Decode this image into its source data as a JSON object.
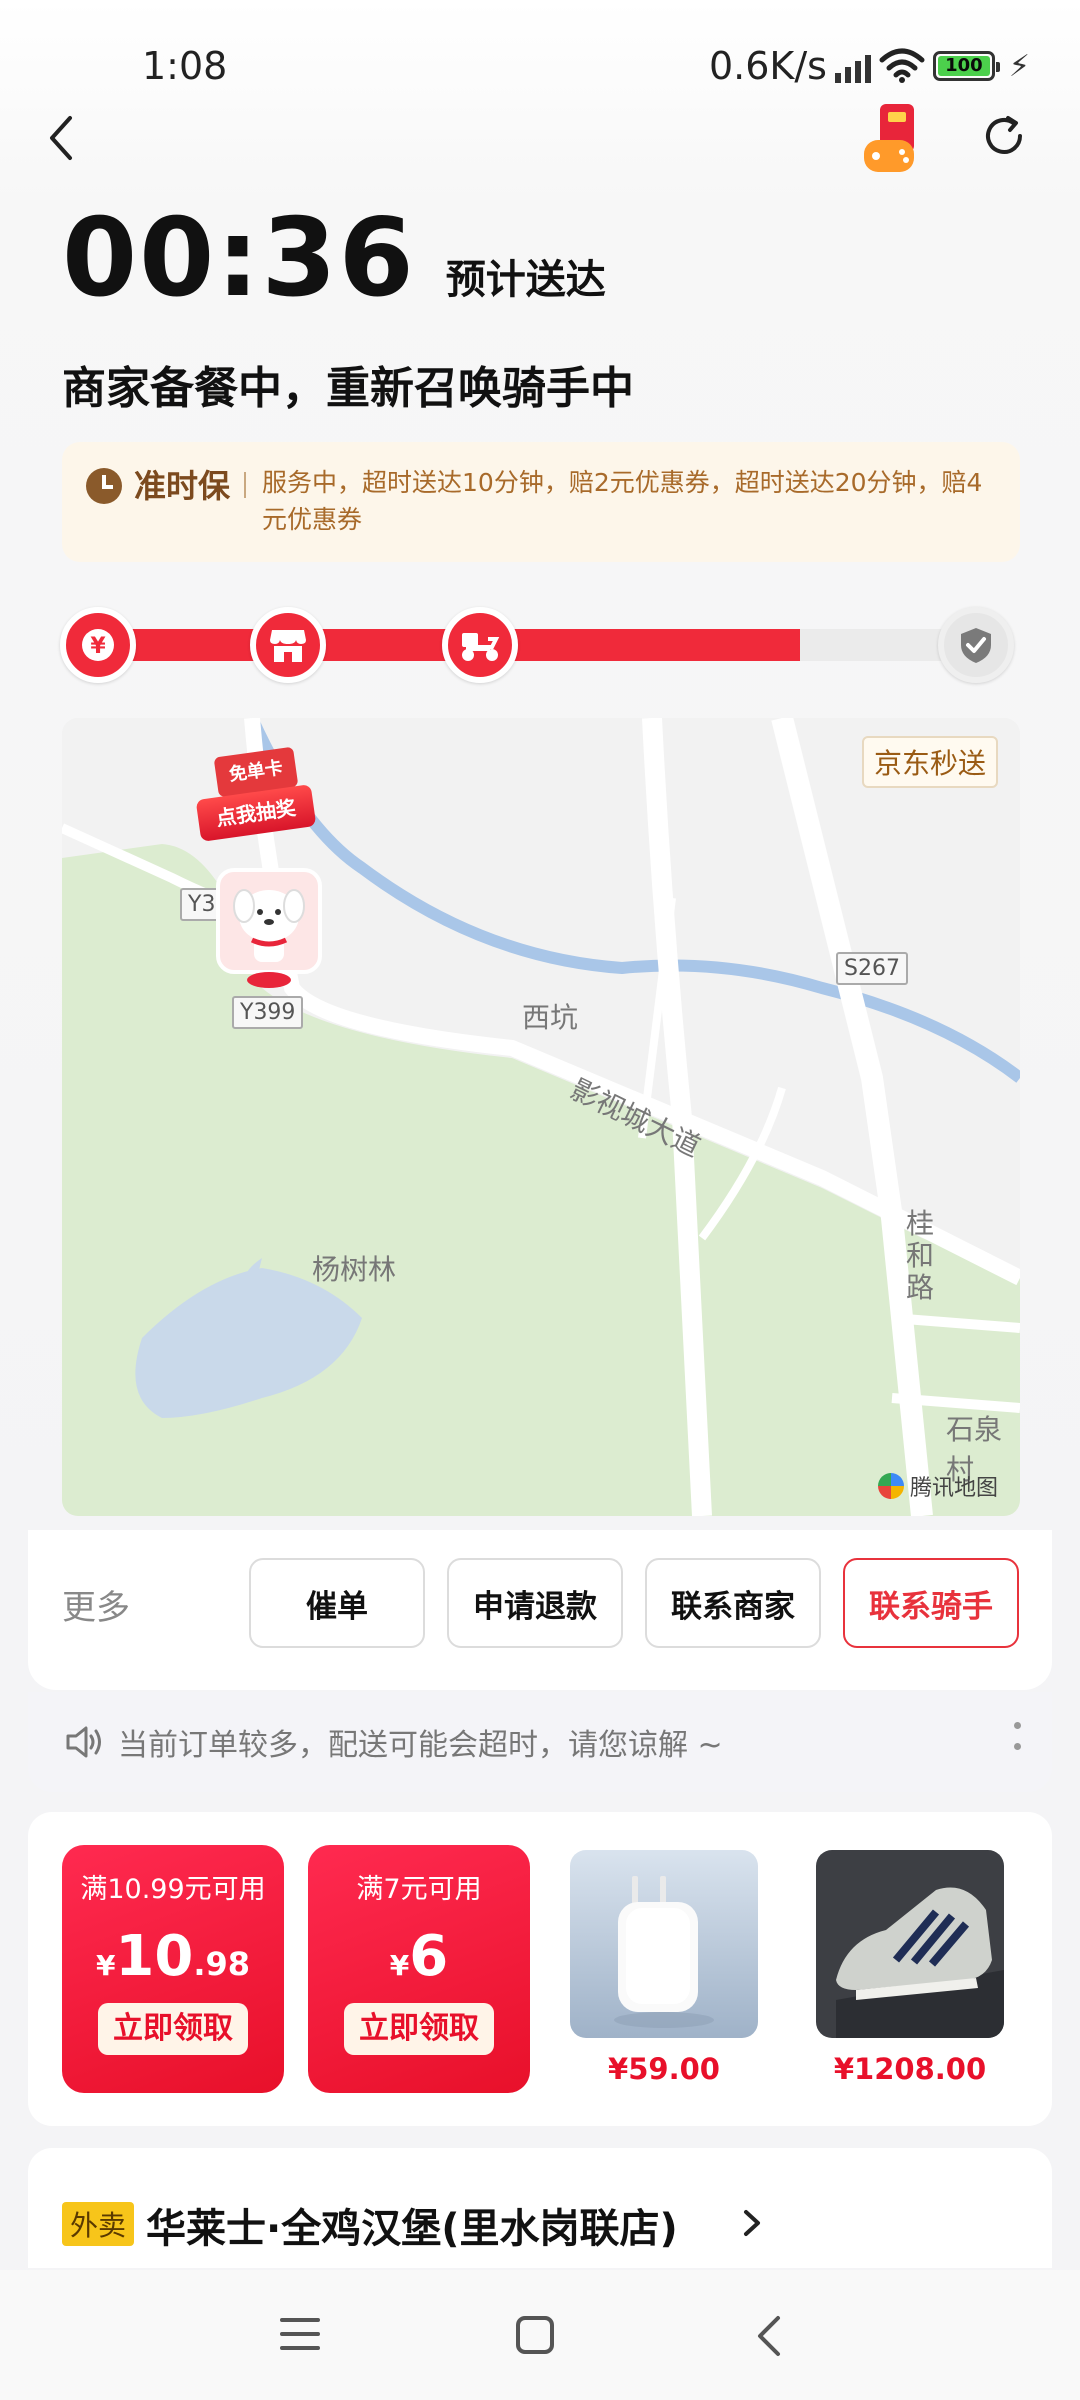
{
  "status_bar": {
    "time": "1:08",
    "net_speed": "0.6K/s",
    "battery": "100"
  },
  "order": {
    "eta_time": "00:36",
    "eta_label": "预计送达",
    "status": "商家备餐中，重新召唤骑手中"
  },
  "guarantee": {
    "title": "准时保",
    "text": "服务中，超时送达10分钟，赔2元优惠券，超时送达20分钟，赔4元优惠券"
  },
  "progress": {
    "steps": [
      "paid",
      "merchant",
      "rider",
      "delivered"
    ],
    "completed_fraction": 0.78
  },
  "map": {
    "badge": "京东秒送",
    "labels": {
      "xikeng": "西坑",
      "yangshulin": "杨树林",
      "road_main": "影视城大道",
      "guihe": "桂和路",
      "shiquan": "石泉村",
      "y399_a": "Y399",
      "y399_b": "Y399",
      "s267": "S267"
    },
    "lottery": {
      "top": "免单卡",
      "bottom": "点我抽奖"
    },
    "attribution": "腾讯地图"
  },
  "actions": {
    "more": "更多",
    "buttons": [
      "催单",
      "申请退款",
      "联系商家",
      "联系骑手"
    ]
  },
  "notice": {
    "text": "当前订单较多，配送可能会超时，请您谅解 ~"
  },
  "promo": {
    "coupons": [
      {
        "condition": "满10.99元可用",
        "currency": "¥",
        "int": "10",
        "dec": ".98",
        "button": "立即领取"
      },
      {
        "condition": "满7元可用",
        "currency": "¥",
        "int": "6",
        "dec": "",
        "button": "立即领取"
      }
    ],
    "products": [
      {
        "name": "charger-adapter",
        "price": "¥59.00"
      },
      {
        "name": "sneaker",
        "price": "¥1208.00"
      }
    ]
  },
  "store": {
    "tag": "外卖",
    "name": "华莱士·全鸡汉堡(里水岗联店)"
  },
  "colors": {
    "accent": "#f02a3a",
    "brand_brown": "#7c4a1e",
    "guarantee_bg": "#fdf6ea"
  }
}
